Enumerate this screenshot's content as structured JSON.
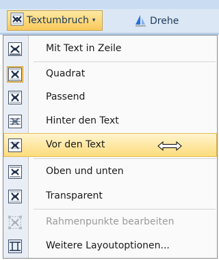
{
  "ribbon": {
    "textumbruch": {
      "label": "Textumbruch",
      "icon": "text-wrap-icon",
      "arrow": "▾"
    },
    "drehen": {
      "label": "Drehe",
      "icon": "rotate-icon"
    }
  },
  "menu": {
    "items": [
      {
        "label": "Mit Text in Zeile",
        "icon": "inline-with-text-icon"
      },
      {
        "label": "Quadrat",
        "icon": "square-wrap-icon",
        "checked": true
      },
      {
        "label": "Passend",
        "icon": "tight-wrap-icon"
      },
      {
        "label": "Hinter den Text",
        "icon": "behind-text-icon"
      },
      {
        "label": "Vor den Text",
        "icon": "in-front-of-text-icon",
        "highlighted": true
      },
      {
        "label": "Oben und unten",
        "icon": "top-bottom-wrap-icon"
      },
      {
        "label": "Transparent",
        "icon": "through-wrap-icon"
      },
      {
        "label": "Rahmenpunkte bearbeiten",
        "icon": "edit-wrap-points-icon",
        "disabled": true
      },
      {
        "label": "Weitere Layoutoptionen...",
        "icon": "more-layout-options-icon"
      }
    ]
  },
  "colors": {
    "highlight": "#fddc7b",
    "text": "#1a1a1a",
    "disabled": "#9a9a9a",
    "ribbon_text": "#1e395b"
  }
}
